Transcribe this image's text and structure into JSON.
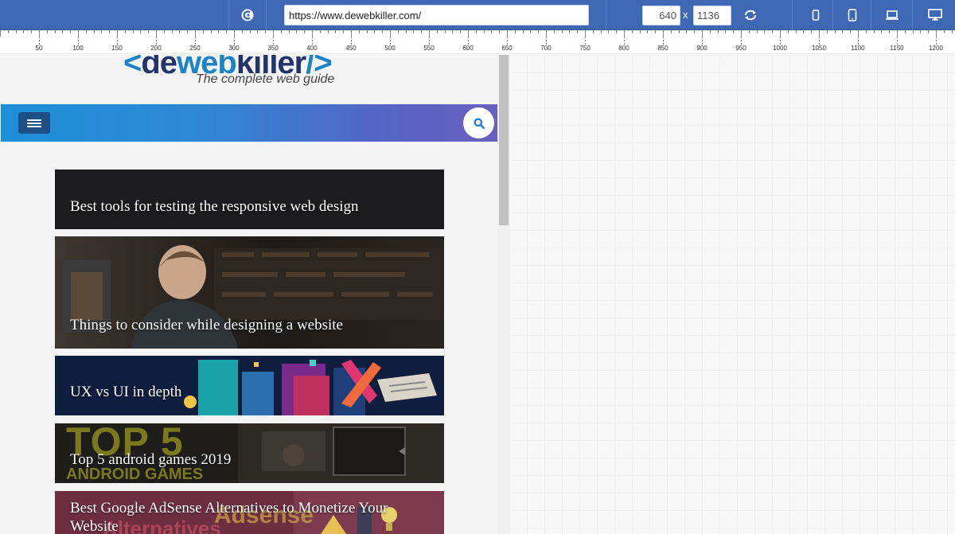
{
  "toolbar": {
    "app_icon": "app-logo-icon",
    "url_value": "https://www.dewebkiller.com/",
    "width_value": "640",
    "height_value": "1136",
    "dimension_separator": "x",
    "icons": {
      "rotate": "rotate-icon",
      "small_phone": "small-phone-icon",
      "phone": "phone-icon",
      "laptop": "laptop-icon",
      "desktop": "desktop-icon"
    },
    "colors": {
      "background": "#3f68b4"
    }
  },
  "ruler": {
    "labels": [
      "50",
      "100",
      "150",
      "200",
      "250",
      "300",
      "350",
      "400",
      "450",
      "500",
      "550",
      "600",
      "650",
      "700",
      "750",
      "800",
      "850",
      "900",
      "950",
      "1000",
      "1050",
      "1100",
      "1150",
      "1200"
    ]
  },
  "site": {
    "logo": {
      "bracket_open": "<",
      "part_de": "de",
      "part_web": "web",
      "part_killer": "killer",
      "bracket_close": "/>",
      "tagline": "The complete web guide"
    },
    "nav": {
      "menu_icon": "hamburger-menu-icon",
      "search_icon": "search-icon"
    },
    "articles": [
      {
        "title": "Best tools for testing the responsive web design"
      },
      {
        "title": "Things to consider while designing a website"
      },
      {
        "title": "UX vs UI in depth"
      },
      {
        "title": "Top 5 android games 2019"
      },
      {
        "title": "Best Google AdSense Alternatives to Monetize Your Website"
      }
    ],
    "image_text": {
      "card4_big": "TOP 5",
      "card4_sub": "ANDROID GAMES",
      "card5_big": "Adsense",
      "card5_sub": "Alternatives"
    },
    "colors": {
      "brand_blue": "#1c84c6",
      "brand_navy": "#23346b"
    }
  }
}
